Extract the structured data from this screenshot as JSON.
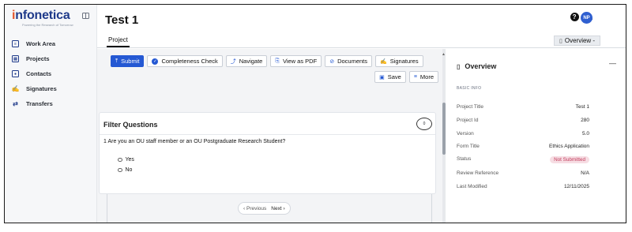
{
  "brand": {
    "name_prefix": "i",
    "name_rest": "nfonetica",
    "tagline": "Powering the Research of Tomorrow"
  },
  "sidebar": {
    "items": [
      {
        "label": "Work Area",
        "icon": "document-icon"
      },
      {
        "label": "Projects",
        "icon": "clipboard-icon"
      },
      {
        "label": "Contacts",
        "icon": "contact-card-icon"
      },
      {
        "label": "Signatures",
        "icon": "signature-icon"
      },
      {
        "label": "Transfers",
        "icon": "transfer-arrows-icon"
      }
    ]
  },
  "header": {
    "title": "Test 1",
    "avatar_initials": "NP"
  },
  "tabs": {
    "project": "Project",
    "overview": "Overview -"
  },
  "toolbar": {
    "submit": "Submit",
    "completeness_check": "Completeness Check",
    "navigate": "Navigate",
    "view_as_pdf": "View as PDF",
    "documents": "Documents",
    "signatures": "Signatures",
    "save": "Save",
    "more": "More"
  },
  "section": {
    "title": "Filter Questions",
    "comment_count": "0",
    "question": "1  Are you an OU staff member or an OU Postgraduate Research Student?",
    "options": [
      "Yes",
      "No"
    ]
  },
  "pager": {
    "previous": "Previous",
    "next": "Next"
  },
  "overview": {
    "title": "Overview",
    "minimize": "—",
    "section_label": "BASIC INFO",
    "fields": [
      {
        "label": "Project Title",
        "value": "Test 1"
      },
      {
        "label": "Project Id",
        "value": "280"
      },
      {
        "label": "Version",
        "value": "5.0"
      },
      {
        "label": "Form Title",
        "value": "Ethics Application"
      },
      {
        "label": "Status",
        "value": "Not Submitted"
      },
      {
        "label": "Review Reference",
        "value": "N/A"
      },
      {
        "label": "Last Modified",
        "value": "12/11/2025"
      }
    ]
  },
  "colors": {
    "accent": "#2458d3",
    "brand": "#1f3a8a",
    "status_badge_bg": "#f6dde3",
    "status_badge_text": "#c23a5a"
  }
}
